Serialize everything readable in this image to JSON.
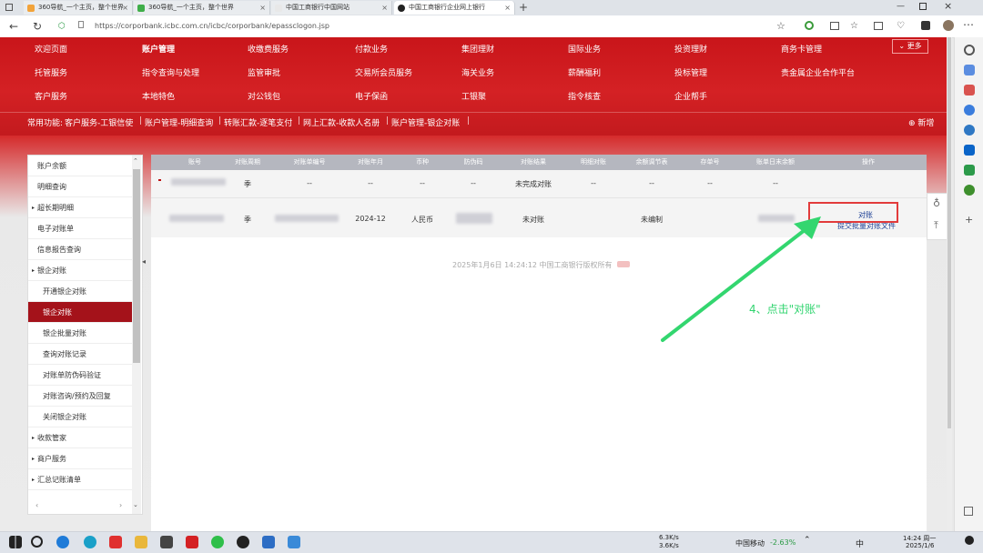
{
  "tabs": [
    {
      "label": "360导航_一个主页，整个世界",
      "active": false,
      "icon_color": "#f2a33a"
    },
    {
      "label": "360导航_一个主页，整个世界",
      "active": false,
      "icon_color": "#3fae49"
    },
    {
      "label": "中国工商银行中国网站",
      "active": false,
      "icon_color": "#e8e8e8"
    },
    {
      "label": "中国工商银行企业网上银行",
      "active": true,
      "icon_color": "#222222"
    }
  ],
  "browser": {
    "url": "https://corporbank.icbc.com.cn/icbc/corporbank/epassclogon.jsp"
  },
  "top_menu": {
    "row1": [
      "欢迎页面",
      "账户管理",
      "收缴费服务",
      "付款业务",
      "集团理财",
      "国际业务",
      "投资理财",
      "商务卡管理"
    ],
    "row2": [
      "托管服务",
      "指令查询与处理",
      "监管审批",
      "交易所会员服务",
      "海关业务",
      "薪酬福利",
      "投标管理",
      "贵金属企业合作平台"
    ],
    "row3": [
      "客户服务",
      "本地特色",
      "对公钱包",
      "电子保函",
      "工银聚",
      "指令核查",
      "企业帮手"
    ],
    "more": "更多"
  },
  "quick_links": {
    "label": "常用功能:",
    "items": [
      "客户服务-工银信使",
      "账户管理-明细查询",
      "转账汇款-逐笔支付",
      "网上汇款-收款人名册",
      "账户管理-银企对账"
    ],
    "add": "新增"
  },
  "left_menu": [
    {
      "label": "账户余额",
      "indent": false,
      "caret": false,
      "active": false
    },
    {
      "label": "明细查询",
      "indent": false,
      "caret": false,
      "active": false
    },
    {
      "label": "超长期明细",
      "indent": false,
      "caret": true,
      "active": false
    },
    {
      "label": "电子对账单",
      "indent": false,
      "caret": false,
      "active": false
    },
    {
      "label": "信息报告查询",
      "indent": false,
      "caret": false,
      "active": false
    },
    {
      "label": "银企对账",
      "indent": false,
      "caret": true,
      "active": false
    },
    {
      "label": "开通银企对账",
      "indent": true,
      "caret": false,
      "active": false
    },
    {
      "label": "银企对账",
      "indent": true,
      "caret": false,
      "active": true
    },
    {
      "label": "银企批量对账",
      "indent": true,
      "caret": false,
      "active": false
    },
    {
      "label": "查询对账记录",
      "indent": true,
      "caret": false,
      "active": false
    },
    {
      "label": "对账单防伪码验证",
      "indent": true,
      "caret": false,
      "active": false
    },
    {
      "label": "对账咨询/预约及回复",
      "indent": true,
      "caret": false,
      "active": false
    },
    {
      "label": "关闭银企对账",
      "indent": true,
      "caret": false,
      "active": false
    },
    {
      "label": "收款管家",
      "indent": false,
      "caret": true,
      "active": false
    },
    {
      "label": "商户服务",
      "indent": false,
      "caret": true,
      "active": false
    },
    {
      "label": "汇总记账清单",
      "indent": false,
      "caret": true,
      "active": false
    }
  ],
  "table": {
    "headers": [
      "账号",
      "对账周期",
      "对账单编号",
      "对账年月",
      "币种",
      "防伪码",
      "对账结果",
      "明细对账",
      "余额调节表",
      "存单号",
      "账单日末余额",
      "操作"
    ],
    "rows": [
      {
        "cells": [
          "",
          "季",
          "--",
          "--",
          "--",
          "--",
          "未完成对账",
          "--",
          "--",
          "--",
          "--",
          ""
        ]
      },
      {
        "cells": [
          "",
          "季",
          "",
          "2024-12",
          "人民币",
          "",
          "未对账",
          "",
          "未编制",
          "",
          "",
          ""
        ],
        "action1": "对账",
        "action2": "提交批量对账文件"
      }
    ]
  },
  "footer_text": "2025年1月6日 14:24:12  中国工商银行版权所有",
  "annotation": "4、点击\"对账\"",
  "taskbar": {
    "net_up": "6.3K/s",
    "net_down": "3.6K/s",
    "stock_name": "中国移动",
    "stock_change": "-2.63%",
    "ime": "中",
    "time": "14:24 周一",
    "date": "2025/1/6"
  },
  "colors": {
    "banner_red": "#cc1b1f",
    "active_menu": "#a4121a",
    "annotation_green": "#2fd46e",
    "highlight_box": "#e23b3b",
    "link_blue": "#1c3f95"
  }
}
